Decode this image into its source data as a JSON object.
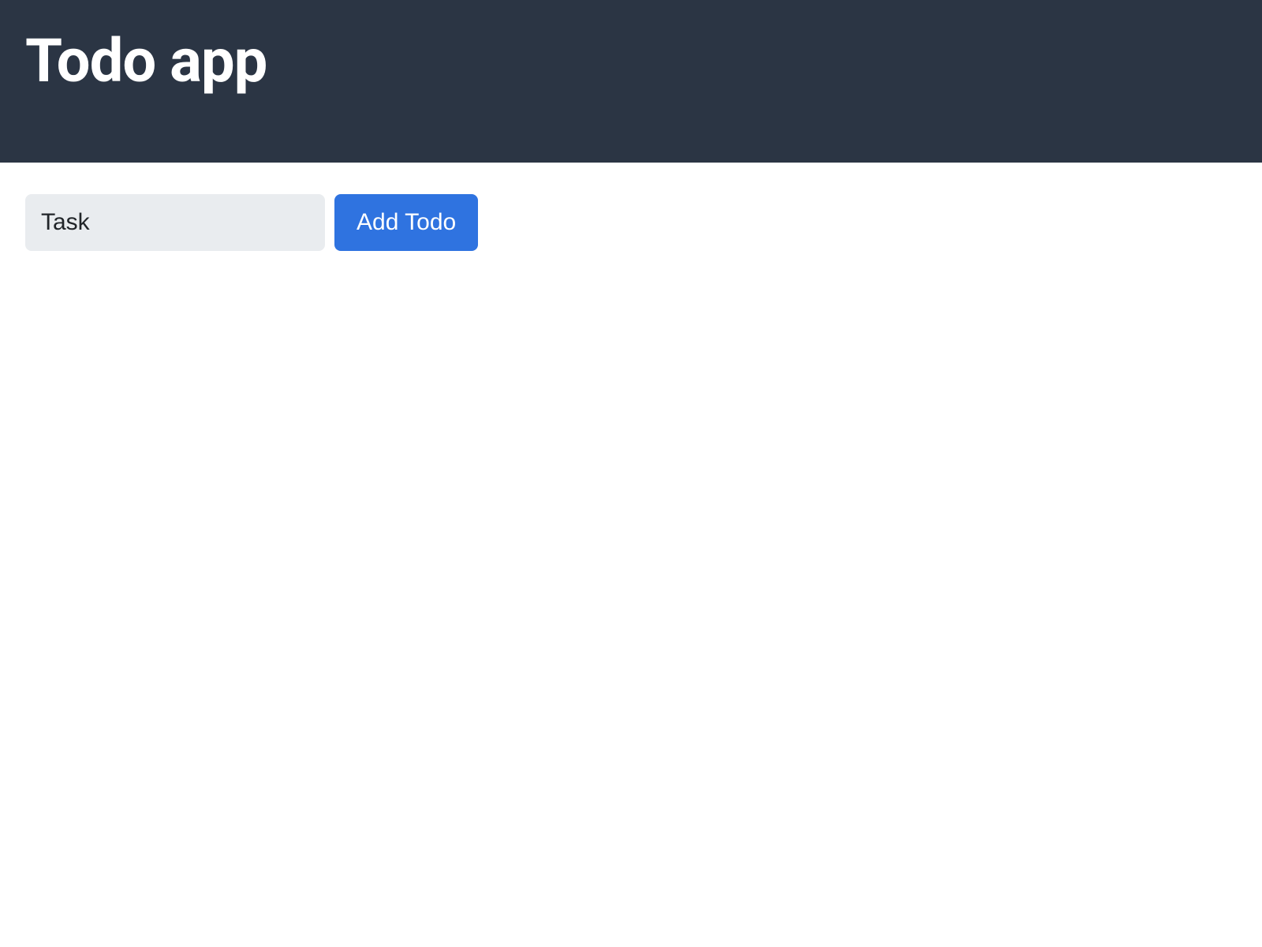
{
  "header": {
    "title": "Todo app"
  },
  "form": {
    "task_placeholder": "Task",
    "task_value": "",
    "add_button_label": "Add Todo"
  }
}
